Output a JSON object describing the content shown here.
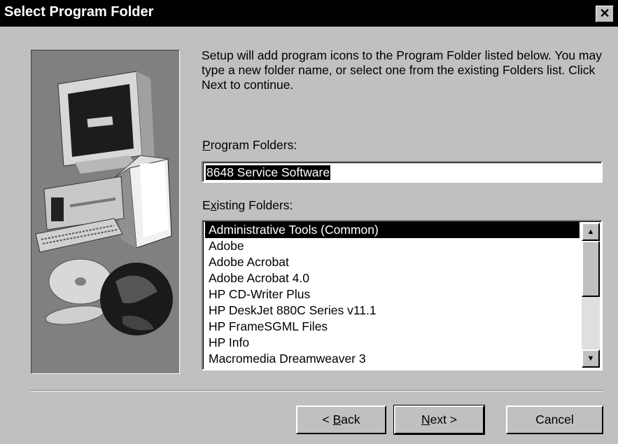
{
  "window": {
    "title": "Select Program Folder",
    "close_label": "✕"
  },
  "description": "Setup will add program icons to the Program Folder listed below. You may type a new folder name, or select one from the existing Folders list.  Click Next to continue.",
  "program_folders": {
    "label_mnemonic": "P",
    "label_rest": "rogram Folders:",
    "value": "8648 Service Software"
  },
  "existing_folders": {
    "label_pre": "E",
    "label_mnemonic": "x",
    "label_rest": "isting Folders:",
    "items": [
      "Administrative Tools (Common)",
      "Adobe",
      "Adobe Acrobat",
      "Adobe Acrobat 4.0",
      "HP CD-Writer Plus",
      "HP DeskJet 880C Series v11.1",
      "HP FrameSGML Files",
      "HP Info",
      "Macromedia Dreamweaver 3"
    ],
    "selected_index": 0
  },
  "scrollbar": {
    "up_icon": "▲",
    "down_icon": "▼"
  },
  "buttons": {
    "back_pre": "< ",
    "back_mnemonic": "B",
    "back_rest": "ack",
    "next_mnemonic": "N",
    "next_rest": "ext >",
    "cancel": "Cancel"
  }
}
